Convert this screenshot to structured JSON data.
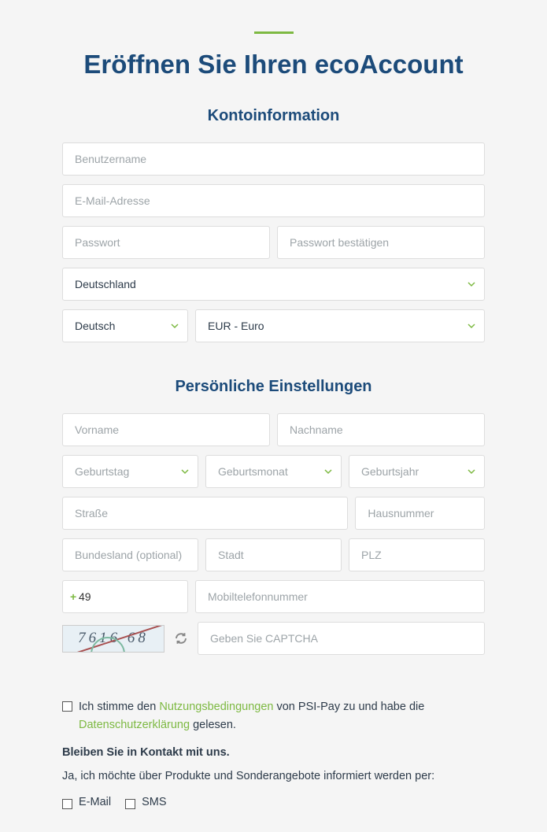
{
  "page_title": "Eröffnen Sie Ihren ecoAccount",
  "section_account": "Kontoinformation",
  "section_personal": "Persönliche Einstellungen",
  "fields": {
    "username": "Benutzername",
    "email": "E-Mail-Adresse",
    "password": "Passwort",
    "password_confirm": "Passwort bestätigen",
    "country": "Deutschland",
    "language": "Deutsch",
    "currency": "EUR - Euro",
    "firstname": "Vorname",
    "lastname": "Nachname",
    "birth_day": "Geburtstag",
    "birth_month": "Geburtsmonat",
    "birth_year": "Geburtsjahr",
    "street": "Straße",
    "house_number": "Hausnummer",
    "state": "Bundesland (optional)",
    "city": "Stadt",
    "zip": "PLZ",
    "phone_prefix": "49",
    "phone": "Mobiltelefonnummer",
    "captcha_value": "7616 68",
    "captcha_input": "Geben Sie CAPTCHA"
  },
  "terms": {
    "agree_prefix": "Ich stimme den ",
    "terms_link": "Nutzungsbedingungen",
    "agree_mid": " von PSI-Pay zu und habe die ",
    "privacy_link": "Datenschutzerklärung",
    "agree_suffix": " gelesen."
  },
  "contact": {
    "heading": "Bleiben Sie in Kontakt mit uns.",
    "info": "Ja, ich möchte über Produkte und Sonderangebote informiert werden per:",
    "email": "E-Mail",
    "sms": "SMS"
  },
  "colors": {
    "primary": "#1c4b7a",
    "accent": "#7db942"
  }
}
